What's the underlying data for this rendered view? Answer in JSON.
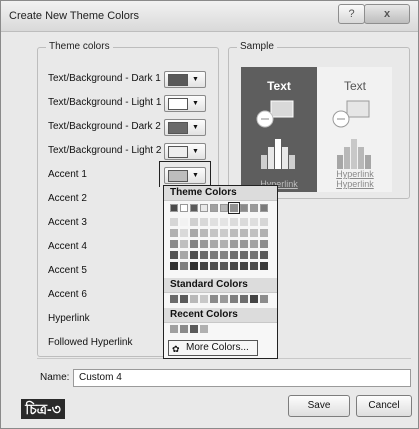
{
  "window": {
    "title": "Create New Theme Colors",
    "help_label": "?",
    "close_label": "x"
  },
  "theme_colors": {
    "group_label": "Theme colors",
    "items": [
      {
        "label": "Text/Background - Dark 1",
        "color": "#595959"
      },
      {
        "label": "Text/Background - Light 1",
        "color": "#ffffff"
      },
      {
        "label": "Text/Background - Dark 2",
        "color": "#6a6a6a"
      },
      {
        "label": "Text/Background - Light 2",
        "color": "#eeeeee"
      },
      {
        "label": "Accent 1",
        "color": "#bdbdbd"
      },
      {
        "label": "Accent 2"
      },
      {
        "label": "Accent 3"
      },
      {
        "label": "Accent 4"
      },
      {
        "label": "Accent 5"
      },
      {
        "label": "Accent 6"
      },
      {
        "label": "Hyperlink"
      },
      {
        "label": "Followed Hyperlink"
      }
    ]
  },
  "sample": {
    "group_label": "Sample",
    "dark_text": "Text",
    "light_text": "Text",
    "dark_hyperlink": "Hyperlink",
    "light_hyperlink": "Hyperlink",
    "light_followed": "Hyperlink"
  },
  "palette": {
    "theme_colors_heading": "Theme Colors",
    "standard_colors_heading": "Standard Colors",
    "recent_colors_heading": "Recent Colors",
    "more_colors_label": "More Colors...",
    "theme_top_row": [
      "#4a4a4a",
      "#ffffff",
      "#5a5a5a",
      "#e8e8e8",
      "#a0a0a0",
      "#b8b8b8",
      "#909090",
      "#8a8a8a",
      "#9a9a9a",
      "#7a7a7a"
    ],
    "theme_shades": [
      [
        "#d6d6d6",
        "#f2f2f2",
        "#d0d0d0",
        "#d8d8d8",
        "#e0e0e0",
        "#e4e4e4",
        "#dcdcdc",
        "#dadada",
        "#dedede",
        "#d6d6d6"
      ],
      [
        "#b0b0b0",
        "#d9d9d9",
        "#a8a8a8",
        "#b8b8b8",
        "#c4c4c4",
        "#cbcbcb",
        "#bcbcbc",
        "#b8b8b8",
        "#c0c0c0",
        "#b0b0b0"
      ],
      [
        "#8a8a8a",
        "#bfbfbf",
        "#828282",
        "#999999",
        "#a8a8a8",
        "#b0b0b0",
        "#9c9c9c",
        "#989898",
        "#a2a2a2",
        "#8c8c8c"
      ],
      [
        "#555555",
        "#a6a6a6",
        "#505050",
        "#6a6a6a",
        "#7a7a7a",
        "#828282",
        "#6e6e6e",
        "#6a6a6a",
        "#747474",
        "#5a5a5a"
      ],
      [
        "#333333",
        "#7f7f7f",
        "#303030",
        "#444444",
        "#505050",
        "#585858",
        "#484848",
        "#444444",
        "#4c4c4c",
        "#383838"
      ]
    ],
    "standard": [
      "#6b6b6b",
      "#5a5a5a",
      "#b8b8b8",
      "#c8c8c8",
      "#8a8a8a",
      "#9a9a9a",
      "#7e7e7e",
      "#6e6e6e",
      "#444444",
      "#8c8c8c"
    ],
    "recent": [
      "#a0a0a0",
      "#8a8a8a",
      "#5a5a5a",
      "#b0b0b0"
    ]
  },
  "name": {
    "label": "Name:",
    "value": "Custom 4"
  },
  "buttons": {
    "save": "Save",
    "cancel": "Cancel"
  },
  "corner_label": "চিত্র-৩"
}
